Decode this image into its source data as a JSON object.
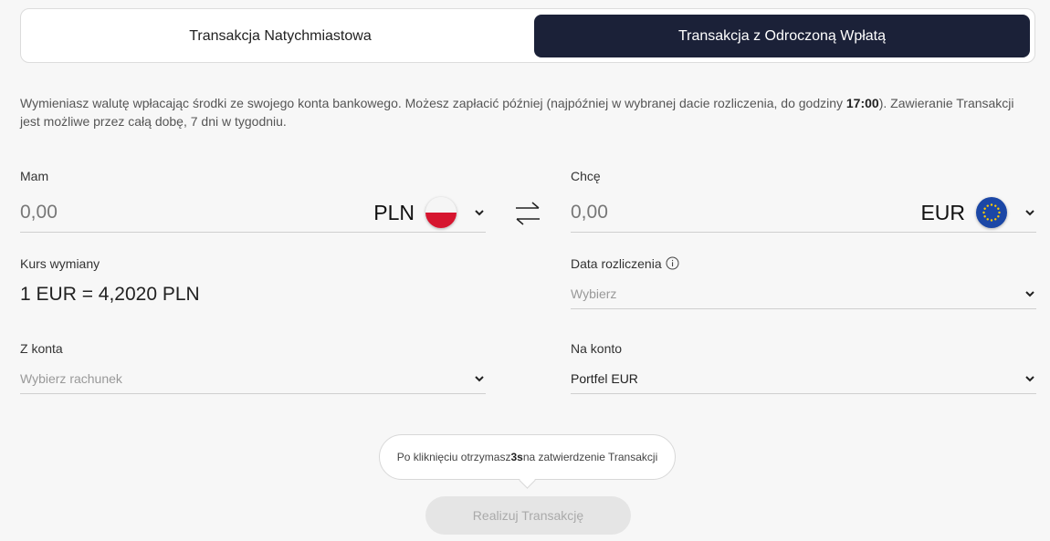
{
  "tabs": [
    {
      "label": "Transakcja Natychmiastowa",
      "active": false
    },
    {
      "label": "Transakcja z Odroczoną Wpłatą",
      "active": true
    }
  ],
  "description": {
    "part1": "Wymieniasz walutę wpłacając środki ze swojego konta bankowego. Możesz zapłacić później (najpóźniej w wybranej dacie rozliczenia, do godziny ",
    "time": "17:00",
    "part2": "). Zawieranie Transakcji jest możliwe przez całą dobę, 7 dni w tygodniu."
  },
  "have": {
    "label": "Mam",
    "amount": "0,00",
    "currency": "PLN",
    "flag_icon": "poland-flag-icon"
  },
  "want": {
    "label": "Chcę",
    "amount": "0,00",
    "currency": "EUR",
    "flag_icon": "eu-flag-icon"
  },
  "swap_icon": "swap-arrows-icon",
  "rate": {
    "label": "Kurs wymiany",
    "prefix": "1 ",
    "base": "EUR",
    "equals": " = ",
    "value": "4,2020",
    "quote": " PLN"
  },
  "settlement_date": {
    "label": "Data rozliczenia",
    "placeholder": "Wybierz",
    "info_icon": "info-icon"
  },
  "from_account": {
    "label": "Z konta",
    "placeholder": "Wybierz rachunek"
  },
  "to_account": {
    "label": "Na konto",
    "value": "Portfel EUR"
  },
  "tooltip": {
    "part1": "Po kliknięciu otrzymasz ",
    "seconds": "3s",
    "part2": " na zatwierdzenie Transakcji"
  },
  "submit_label": "Realizuj Transakcję",
  "colors": {
    "active_tab_bg": "#1b2138",
    "pl_red": "#d6152f",
    "eu_blue": "#1b47a6",
    "eu_star": "#ffcc00"
  }
}
